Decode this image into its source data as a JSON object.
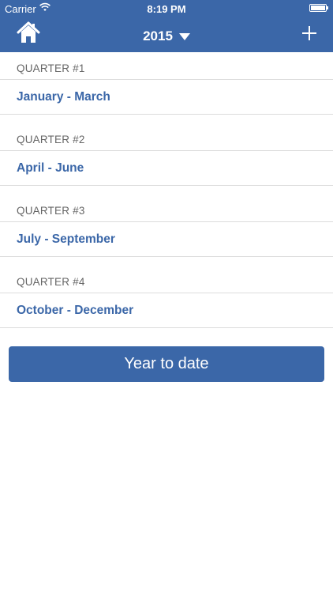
{
  "status_bar": {
    "carrier": "Carrier",
    "time": "8:19 PM",
    "wifi_icon": "wifi-icon",
    "battery_icon": "battery-icon"
  },
  "nav": {
    "year": "2015",
    "home_icon": "home-icon",
    "add_icon": "plus-icon",
    "dropdown_icon": "caret-down-icon"
  },
  "quarters": [
    {
      "header": "QUARTER #1",
      "range": "January - March"
    },
    {
      "header": "QUARTER #2",
      "range": "April - June"
    },
    {
      "header": "QUARTER #3",
      "range": "July - September"
    },
    {
      "header": "QUARTER #4",
      "range": "October - December"
    }
  ],
  "year_to_date_label": "Year to date",
  "colors": {
    "accent": "#3b67a8",
    "header_text": "#666666",
    "divider": "#dcdcdc"
  }
}
